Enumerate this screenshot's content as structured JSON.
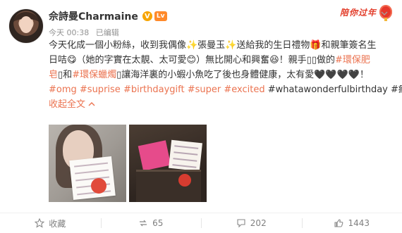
{
  "header": {
    "username": "佘詩曼Charmaine",
    "verified_badge": "V",
    "level_badge": "Lv",
    "time": "今天 00:38",
    "source": "已编辑",
    "promo_text": "陪你过年"
  },
  "post": {
    "lines": [
      [
        "今天化成一個小粉絲，收到我偶像✨張曼玉✨送給我的生日禮物",
        "🎁",
        "和親筆簽名生"
      ],
      [
        "日咭😋（她的字實在太靚、太可愛😊）無比開心和興奮😆！親手",
        "",
        "做的",
        "#環保肥"
      ],
      [
        "皂",
        "",
        "和",
        "#環保蠟燭",
        "",
        "讓海洋裏的小蝦小魚吃了後也身體健康，太有愛🖤🖤🖤🖤！"
      ],
      [
        "#omg",
        "#suprise",
        "#birthdaygift",
        "#super",
        "#excited",
        "#whatawonderfulbirthday",
        "#瘋了"
      ]
    ],
    "line1": "今天化成一個小粉絲，收到我偶像✨張曼玉✨送給我的生日禮物🎁和親筆簽名生",
    "line2_a": "日咭😋（她的字實在太靚、太可愛😊）無比開心和興奮😆！親手",
    "line2_b": "做的",
    "line2_tag": "#環保肥",
    "line3_tag1": "皂",
    "line3_and": "和",
    "line3_tag2": "#環保蠟燭",
    "line3_rest": "讓海洋裏的小蝦小魚吃了後也身體健康，太有愛🖤🖤🖤🖤！",
    "tags": [
      "#omg",
      "#suprise",
      "#birthdaygift",
      "#super",
      "#excited",
      "#whatawonderfulbirthday",
      "#瘋了"
    ],
    "collapse": "收起全文",
    "collapse_icon": "chevron-up-icon"
  },
  "actions": {
    "favorite_label": "收藏",
    "repost_count": "65",
    "comment_count": "202",
    "like_count": "1443"
  },
  "colors": {
    "accent": "#eb7350",
    "promo": "#e23b28",
    "muted": "#939393"
  }
}
